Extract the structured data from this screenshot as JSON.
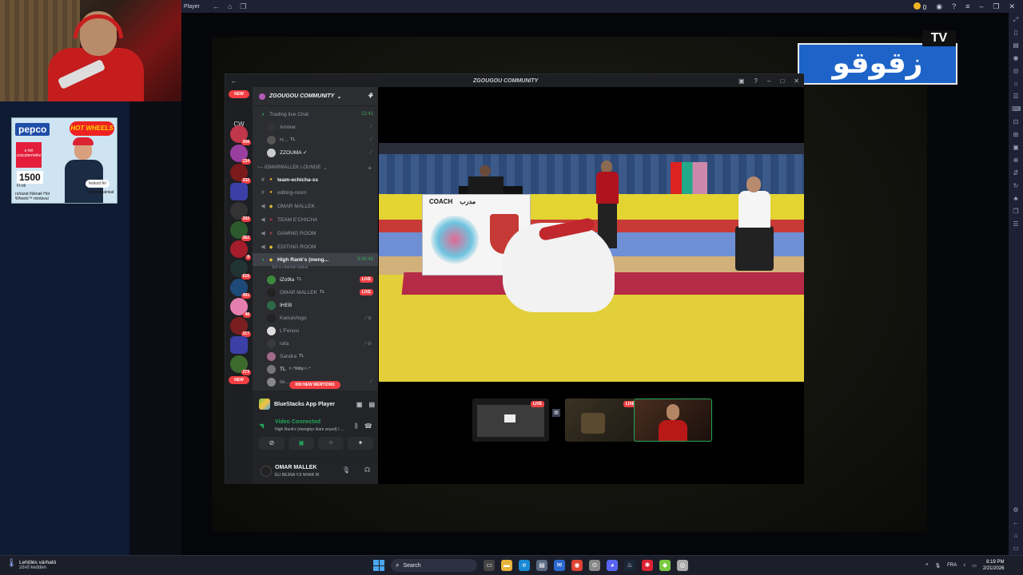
{
  "app": {
    "title": "Player"
  },
  "topbar": {
    "coins": "0",
    "nav_icons": [
      "back-icon",
      "home-icon",
      "tabs-icon"
    ],
    "right_icons": [
      "coin-icon",
      "account-icon",
      "help-icon",
      "menu-icon",
      "minimize-icon",
      "restore-icon",
      "close-icon"
    ]
  },
  "ad": {
    "brand": "pepco",
    "partner": "HOT WHEELS",
    "box_text": "a hét csúcsterméke",
    "price": "1500",
    "price_unit": "Ft-tól",
    "tagline": "ruházat fiúknak Hot Wheels™ mintával",
    "cta": "fedezd fel",
    "cta2": "újdonságainkat"
  },
  "logo": {
    "tv": "TV",
    "arabic": "زقوقو"
  },
  "discord": {
    "window_title": "ZGOUGOU COMMUNITY",
    "server_name": "ZGOUGOU COMMUNITY",
    "cw_label": "CW",
    "new_label": "NEW",
    "guild_badges": [
      "308",
      "134",
      "332",
      "292",
      "362",
      "8",
      "616",
      "491",
      "48",
      "217",
      "273"
    ],
    "channels": [
      {
        "label": "Trading live Chat",
        "time": "22:41",
        "icon": "voice-icon"
      },
      {
        "label": "Amixer",
        "user": true
      },
      {
        "label": "H...",
        "tag": "TL",
        "user": true
      },
      {
        "label": "ZZOUMA ✓",
        "user": true
      }
    ],
    "category": "IOMARMALLEK LOUNGE",
    "rooms": [
      {
        "label": "team-echicha-ss",
        "icon": "text-channel-icon",
        "bright": true
      },
      {
        "label": "editing-room",
        "icon": "text-channel-icon"
      },
      {
        "label": "OMAR MALLEK",
        "icon": "speaker-icon"
      },
      {
        "label": "TEAM E'CHICHA",
        "icon": "speaker-icon"
      },
      {
        "label": "GAMING ROOM",
        "icon": "speaker-icon"
      },
      {
        "label": "EDITING ROOM",
        "icon": "speaker-icon"
      }
    ],
    "active_voice": {
      "label": "High Rank's (meng...",
      "time": "9:06:46",
      "set_status": "Set a channel status"
    },
    "voice_users": [
      {
        "name": "IZo9la",
        "tag": "TL",
        "live": "LIVE"
      },
      {
        "name": "OMAR MALLEK",
        "tag": "TL",
        "live": "LIVE"
      },
      {
        "name": "IHEB"
      },
      {
        "name": "KamaVingo"
      },
      {
        "name": "L'Fenssi"
      },
      {
        "name": "rafa"
      },
      {
        "name": "Sandra",
        "tag": "TL"
      },
      {
        "name": "TL",
        "tag": "✧˖°Kitty✧˖°"
      },
      {
        "name": "tw..."
      }
    ],
    "mentions": "690 NEW MENTIONS",
    "voice_panel": {
      "app_name": "BlueStacks App Player",
      "connected": "Video Connected",
      "channel": "High Rank's (menghyr klam zeyed) / ...",
      "username": "OMAR MALLEK",
      "user_status": "ELI BE3NA YJI NHAR W"
    },
    "thumb_live": "LIVE"
  },
  "taskbar": {
    "weather_title": "Lehűlés várható",
    "weather_sub": "zövő kedden",
    "search": "Search",
    "lang": "FRA",
    "time": "8:19 PM",
    "date": "2/21/2026"
  },
  "colors": {
    "accent_green": "#23a55a",
    "live_red": "#ed4245",
    "discord_bg": "#2b2d31",
    "logo_blue": "#1e64c8"
  }
}
